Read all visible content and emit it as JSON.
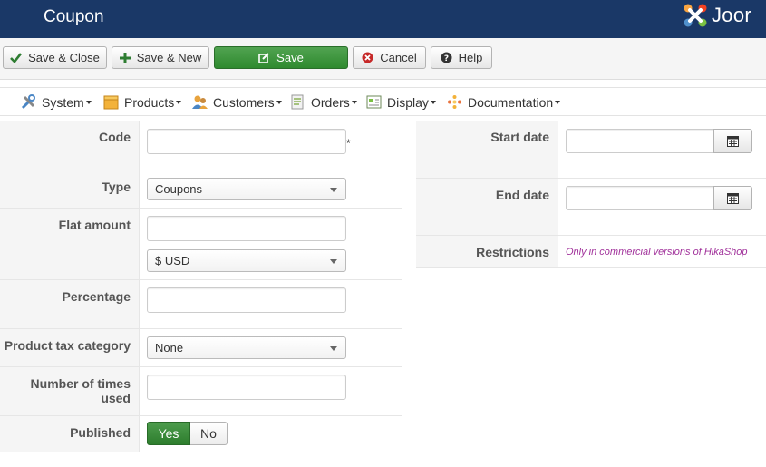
{
  "header": {
    "title": "Coupon",
    "logo_text": "Joor"
  },
  "toolbar": {
    "save_close": "Save & Close",
    "save_new": "Save & New",
    "save": "Save",
    "cancel": "Cancel",
    "help": "Help"
  },
  "menu": {
    "items": [
      {
        "label": "System",
        "icon": "tools-icon"
      },
      {
        "label": "Products",
        "icon": "box-icon"
      },
      {
        "label": "Customers",
        "icon": "users-icon"
      },
      {
        "label": "Orders",
        "icon": "orders-icon"
      },
      {
        "label": "Display",
        "icon": "display-icon"
      },
      {
        "label": "Documentation",
        "icon": "docs-icon"
      }
    ]
  },
  "form": {
    "code_label": "Code",
    "code_value": "",
    "required_mark": "*",
    "type_label": "Type",
    "type_value": "Coupons",
    "flat_amount_label": "Flat amount",
    "flat_amount_value": "",
    "currency_value": "$ USD",
    "percentage_label": "Percentage",
    "percentage_value": "",
    "tax_label": "Product tax category",
    "tax_value": "None",
    "times_used_label": "Number of times used",
    "times_used_value": "",
    "published_label": "Published",
    "yes": "Yes",
    "no": "No",
    "start_date_label": "Start date",
    "start_date_value": "",
    "end_date_label": "End date",
    "end_date_value": "",
    "restrictions_label": "Restrictions",
    "restrictions_note": "Only in commercial versions of HikaShop"
  },
  "colors": {
    "header_bg": "#1a3867",
    "save_green": "#3c963c",
    "note_purple": "#a0309a"
  }
}
